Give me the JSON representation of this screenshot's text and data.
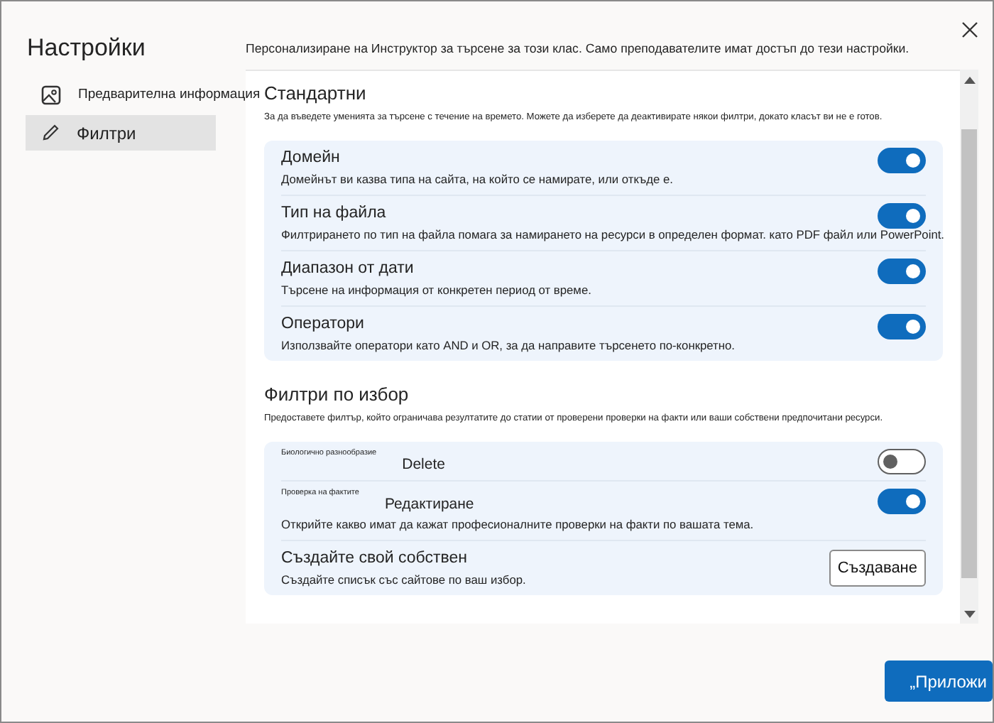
{
  "sidebar": {
    "title": "Настройки",
    "items": [
      {
        "label": "Предварителна информация",
        "selected": false
      },
      {
        "label": "Филтри",
        "selected": true
      }
    ]
  },
  "header": "Персонализиране на Инструктор за търсене за този клас. Само преподавателите имат достъп до тези настройки.",
  "sections": [
    {
      "title": "Стандартни",
      "description": "За да въведете уменията за търсене с течение на времето. Можете да изберете да деактивирате някои филтри, докато класът ви не е готов.",
      "rows": [
        {
          "kind": "toggle",
          "title": "Домейн",
          "description": "Домейнът ви казва типа на сайта, на който се намирате, или откъде е.",
          "on": true
        },
        {
          "kind": "toggle",
          "title": "Тип на файла",
          "description": "Филтрирането по тип на файла помага за намирането на ресурси в определен формат. като PDF файл или PowerPoint.",
          "on": true
        },
        {
          "kind": "toggle",
          "title": "Диапазон от дати",
          "description": "Търсене на информация от конкретен период от време.",
          "on": true
        },
        {
          "kind": "toggle",
          "title": "Оператори",
          "description": "Използвайте оператори като AND и OR, за да направите търсенето по-конкретно.",
          "on": true
        }
      ]
    },
    {
      "title": "Филтри по избор",
      "description": "Предоставете филтър, който ограничава резултатите до статии от проверени проверки на факти или ваши собствени предпочитани ресурси.",
      "rows": [
        {
          "kind": "custom",
          "small_label": "Биологично разнообразие",
          "label": "Delete",
          "on": false
        },
        {
          "kind": "custom",
          "small_label": "Проверка на фактите",
          "label": "Редактиране",
          "description": "Открийте какво имат да кажат професионалните проверки на факти по вашата тема.",
          "on": true
        },
        {
          "kind": "button",
          "title": "Създайте свой собствен",
          "description": "Създайте списък със сайтове по ваш избор.",
          "button": "Създаване"
        }
      ]
    }
  ],
  "apply_button": "„Приложи"
}
